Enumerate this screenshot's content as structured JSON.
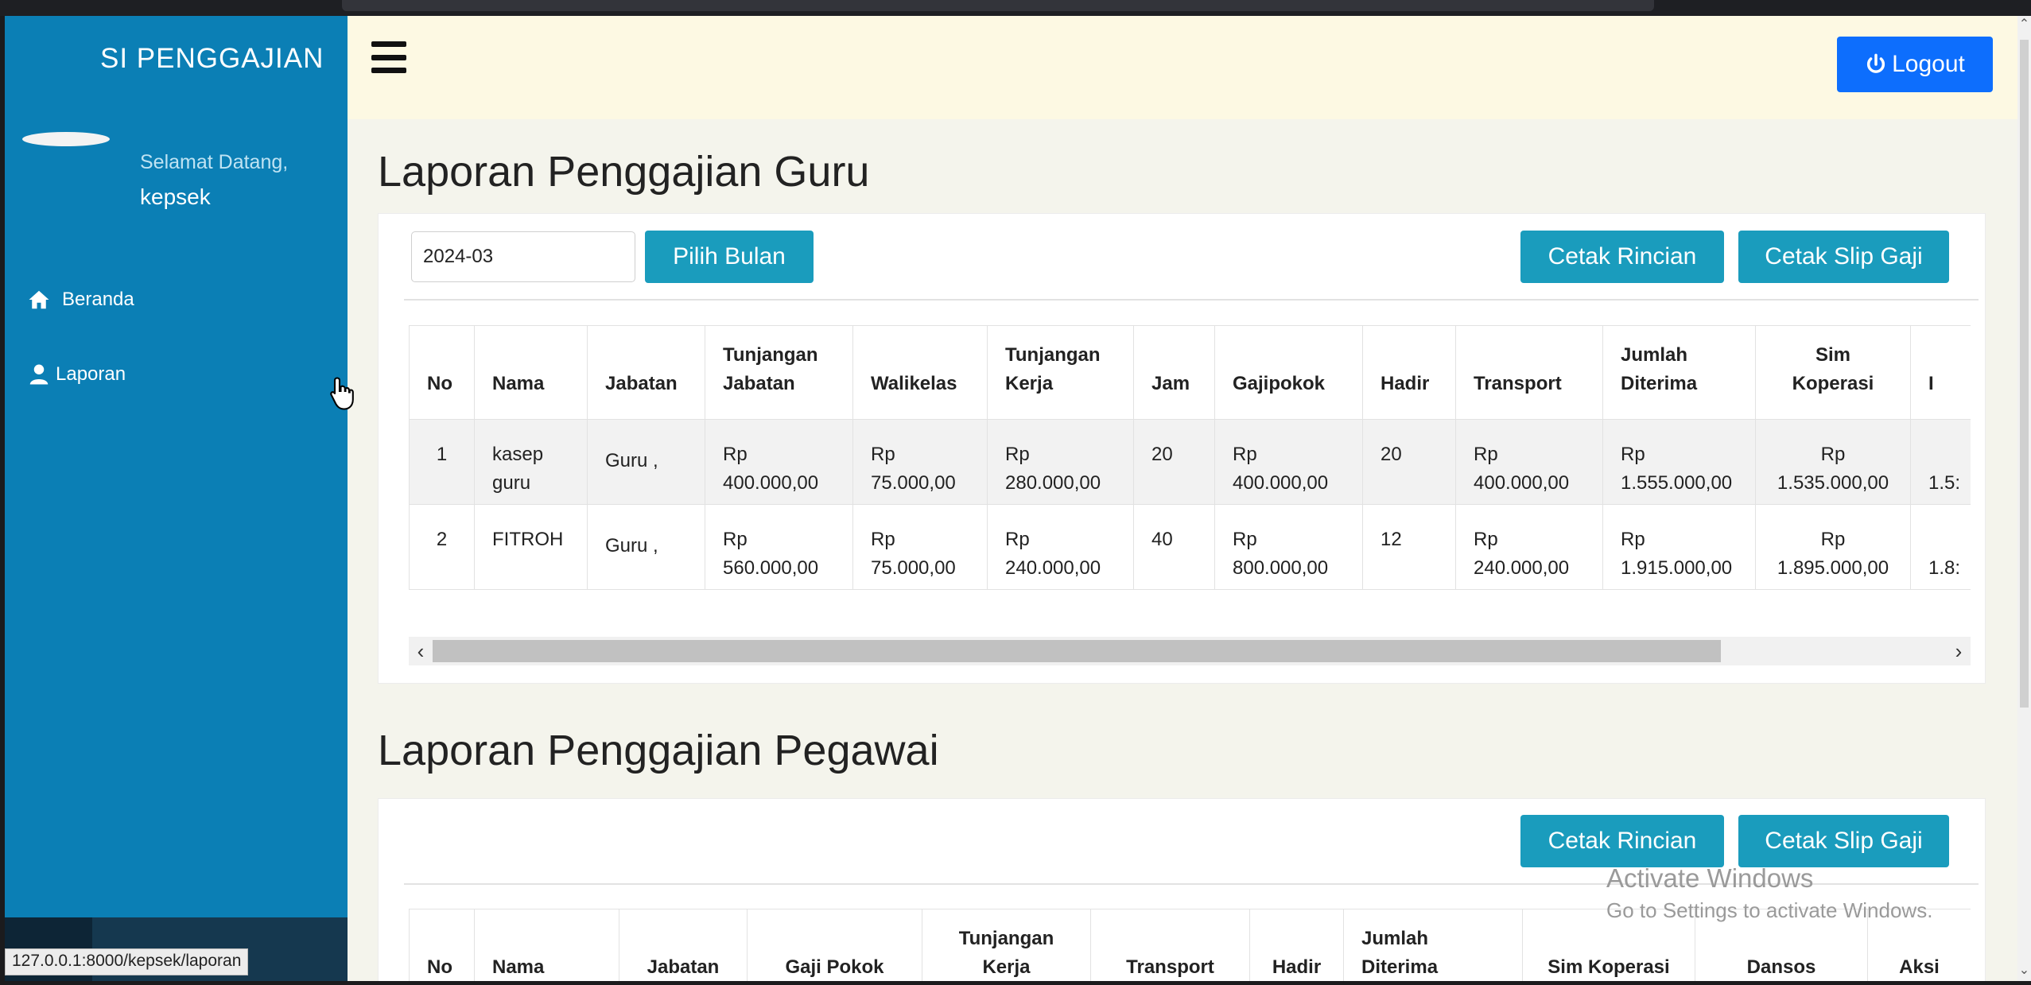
{
  "sidebar": {
    "brand": "SI PENGGAJIAN",
    "welcome": "Selamat Datang,",
    "username": "kepsek",
    "items": [
      {
        "label": "Beranda",
        "icon": "home-icon"
      },
      {
        "label": "Laporan",
        "icon": "user-icon"
      }
    ]
  },
  "header": {
    "logout_label": "Logout"
  },
  "guru": {
    "title": "Laporan Penggajian Guru",
    "month_value": "2024-03",
    "pick_month_label": "Pilih Bulan",
    "print_detail_label": "Cetak Rincian",
    "print_slip_label": "Cetak Slip Gaji",
    "columns": [
      "No",
      "Nama",
      "Jabatan",
      "Tunjangan Jabatan",
      "Walikelas",
      "Tunjangan Kerja",
      "Jam",
      "Gajipokok",
      "Hadir",
      "Transport",
      "Jumlah Diterima",
      "Sim Koperasi",
      "I"
    ],
    "rows": [
      [
        "1",
        "kasep guru",
        "Guru ,",
        "Rp 400.000,00",
        "Rp 75.000,00",
        "Rp 280.000,00",
        "20",
        "Rp 400.000,00",
        "20",
        "Rp 400.000,00",
        "Rp 1.555.000,00",
        "Rp 1.535.000,00",
        "1.5:"
      ],
      [
        "2",
        "FITROH",
        "Guru ,",
        "Rp 560.000,00",
        "Rp 75.000,00",
        "Rp 240.000,00",
        "40",
        "Rp 800.000,00",
        "12",
        "Rp 240.000,00",
        "Rp 1.915.000,00",
        "Rp 1.895.000,00",
        "1.8:"
      ]
    ]
  },
  "pegawai": {
    "title": "Laporan Penggajian Pegawai",
    "print_detail_label": "Cetak Rincian",
    "print_slip_label": "Cetak Slip Gaji",
    "columns": [
      "No",
      "Nama",
      "Jabatan",
      "Gaji Pokok",
      "Tunjangan Kerja",
      "Transport",
      "Hadir",
      "Jumlah Diterima",
      "Sim Koperasi",
      "Dansos",
      "Aksi"
    ]
  },
  "watermark": {
    "line1": "Activate Windows",
    "line2": "Go to Settings to activate Windows."
  },
  "statusbar": {
    "url": "127.0.0.1:8000/kepsek/laporan"
  },
  "colors": {
    "sidebar": "#0b7fb5",
    "header": "#fdf9e3",
    "content_bg": "#f4f4ec",
    "button": "#1a9cbd",
    "logout": "#0d6efd"
  }
}
